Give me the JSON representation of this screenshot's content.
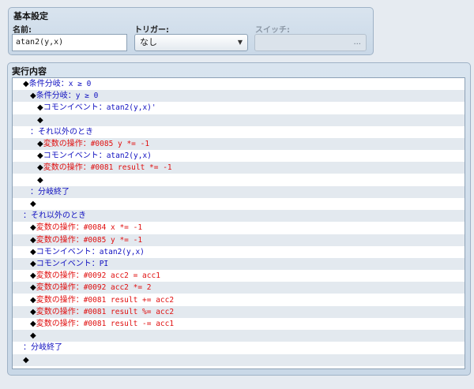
{
  "basic": {
    "title": "基本設定",
    "name_label": "名前:",
    "name_value": "atan2(y,x)",
    "trigger_label": "トリガー:",
    "trigger_value": "なし",
    "switch_label": "スイッチ:",
    "switch_button": "..."
  },
  "exec": {
    "title": "実行内容",
    "rows": [
      {
        "indent": 1,
        "diamond": "◆",
        "prefix": "条件分岐：",
        "detail": "x ≥ 0",
        "color": "blue"
      },
      {
        "indent": 2,
        "diamond": "◆",
        "prefix": "条件分岐：",
        "detail": "y ≥ 0",
        "color": "blue"
      },
      {
        "indent": 3,
        "diamond": "◆",
        "prefix": "コモンイベント：",
        "detail": "atan2(y,x)'",
        "color": "blue"
      },
      {
        "indent": 3,
        "diamond": "◆",
        "prefix": "",
        "detail": "",
        "color": "black"
      },
      {
        "indent": 2,
        "diamond": "",
        "prefix": "：それ以外のとき",
        "detail": "",
        "color": "blue"
      },
      {
        "indent": 3,
        "diamond": "◆",
        "prefix": "変数の操作：",
        "detail": "#0085 y *= -1",
        "color": "red"
      },
      {
        "indent": 3,
        "diamond": "◆",
        "prefix": "コモンイベント：",
        "detail": "atan2(y,x)",
        "color": "blue"
      },
      {
        "indent": 3,
        "diamond": "◆",
        "prefix": "変数の操作：",
        "detail": "#0081 result *= -1",
        "color": "red"
      },
      {
        "indent": 3,
        "diamond": "◆",
        "prefix": "",
        "detail": "",
        "color": "black"
      },
      {
        "indent": 2,
        "diamond": "",
        "prefix": "：分岐終了",
        "detail": "",
        "color": "blue"
      },
      {
        "indent": 2,
        "diamond": "◆",
        "prefix": "",
        "detail": "",
        "color": "black"
      },
      {
        "indent": 1,
        "diamond": "",
        "prefix": "：それ以外のとき",
        "detail": "",
        "color": "blue"
      },
      {
        "indent": 2,
        "diamond": "◆",
        "prefix": "変数の操作：",
        "detail": "#0084 x *= -1",
        "color": "red"
      },
      {
        "indent": 2,
        "diamond": "◆",
        "prefix": "変数の操作：",
        "detail": "#0085 y *= -1",
        "color": "red"
      },
      {
        "indent": 2,
        "diamond": "◆",
        "prefix": "コモンイベント：",
        "detail": "atan2(y,x)",
        "color": "blue"
      },
      {
        "indent": 2,
        "diamond": "◆",
        "prefix": "コモンイベント：",
        "detail": "PI",
        "color": "blue"
      },
      {
        "indent": 2,
        "diamond": "◆",
        "prefix": "変数の操作：",
        "detail": "#0092 acc2 = acc1",
        "color": "red"
      },
      {
        "indent": 2,
        "diamond": "◆",
        "prefix": "変数の操作：",
        "detail": "#0092 acc2 *= 2",
        "color": "red"
      },
      {
        "indent": 2,
        "diamond": "◆",
        "prefix": "変数の操作：",
        "detail": "#0081 result += acc2",
        "color": "red"
      },
      {
        "indent": 2,
        "diamond": "◆",
        "prefix": "変数の操作：",
        "detail": "#0081 result %= acc2",
        "color": "red"
      },
      {
        "indent": 2,
        "diamond": "◆",
        "prefix": "変数の操作：",
        "detail": "#0081 result -= acc1",
        "color": "red"
      },
      {
        "indent": 2,
        "diamond": "◆",
        "prefix": "",
        "detail": "",
        "color": "black"
      },
      {
        "indent": 1,
        "diamond": "",
        "prefix": "：分岐終了",
        "detail": "",
        "color": "blue"
      },
      {
        "indent": 1,
        "diamond": "◆",
        "prefix": "",
        "detail": "",
        "color": "black"
      },
      {
        "indent": 0,
        "diamond": "",
        "prefix": "",
        "detail": "",
        "color": "black"
      }
    ]
  }
}
